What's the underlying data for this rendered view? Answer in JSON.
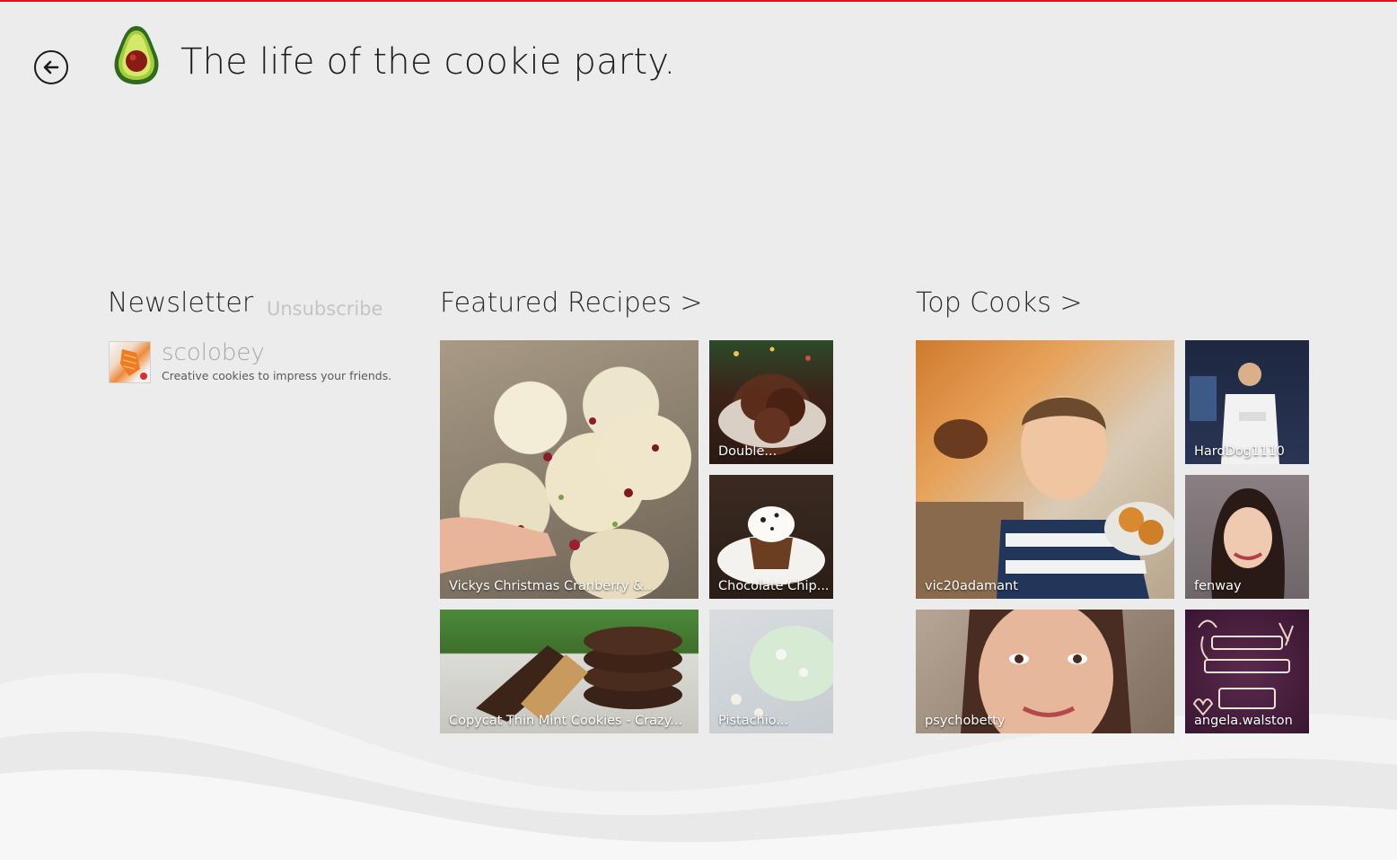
{
  "header": {
    "title": "The life of the cookie party.",
    "back_icon": "back-arrow-icon",
    "logo_icon": "avocado-logo-icon"
  },
  "colors": {
    "accent": "#d9121b",
    "background": "#ececec"
  },
  "newsletter": {
    "heading": "Newsletter",
    "unsubscribe_label": "Unsubscribe",
    "subscription": {
      "name": "scolobey",
      "description": "Creative cookies to impress your friends."
    }
  },
  "featured": {
    "heading": "Featured Recipes >",
    "items": [
      {
        "label": "Vickys Christmas Cranberry &..."
      },
      {
        "label": "Double..."
      },
      {
        "label": "Chocolate Chip..."
      },
      {
        "label": "Copycat Thin Mint Cookies - Crazy..."
      },
      {
        "label": "Pistachio..."
      }
    ]
  },
  "cooks": {
    "heading": "Top Cooks >",
    "items": [
      {
        "label": "vic20adamant"
      },
      {
        "label": "HardDog1110"
      },
      {
        "label": "fenway"
      },
      {
        "label": "psychobetty"
      },
      {
        "label": "angela.walston"
      }
    ]
  }
}
